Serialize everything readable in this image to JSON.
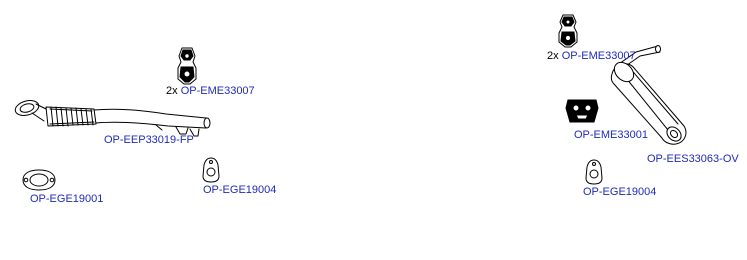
{
  "diagram": {
    "parts": [
      {
        "id": "hanger-left",
        "qty": "2x",
        "code": "OP-EME33007"
      },
      {
        "id": "front-pipe",
        "qty": "",
        "code": "OP-EEP33019-FP"
      },
      {
        "id": "gasket-left-1",
        "qty": "",
        "code": "OP-EGE19001"
      },
      {
        "id": "gasket-left-2",
        "qty": "",
        "code": "OP-EGE19004"
      },
      {
        "id": "hanger-right-top",
        "qty": "2x",
        "code": "OP-EME33007"
      },
      {
        "id": "hanger-right-mid",
        "qty": "",
        "code": "OP-EME33001"
      },
      {
        "id": "rear-silencer",
        "qty": "",
        "code": "OP-EES33063-OV"
      },
      {
        "id": "gasket-right",
        "qty": "",
        "code": "OP-EGE19004"
      }
    ]
  }
}
